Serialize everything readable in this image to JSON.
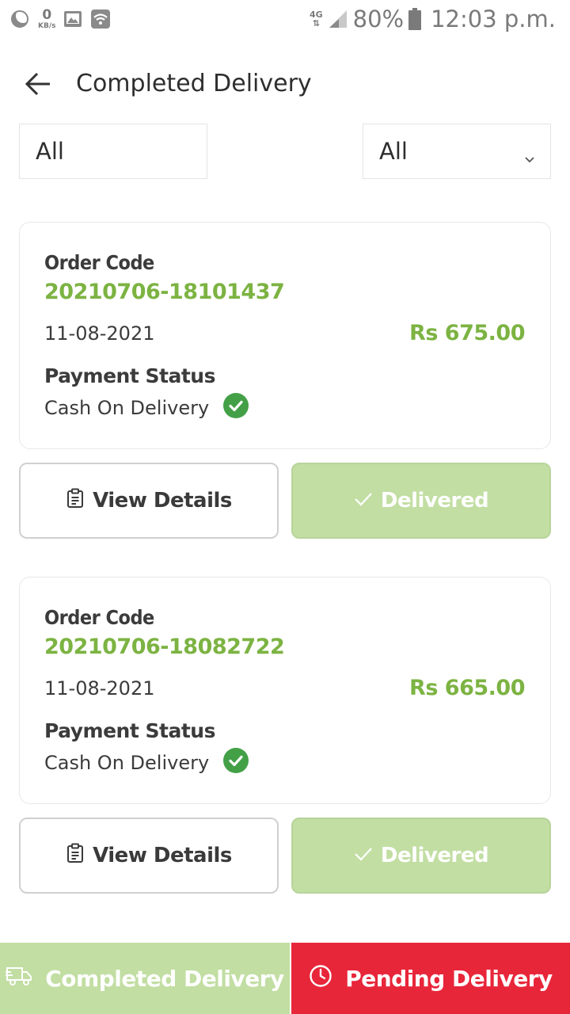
{
  "status_bar": {
    "speed_value": "0",
    "speed_unit": "KB/s",
    "network": "4G",
    "battery": "80%",
    "time": "12:03 p.m."
  },
  "header": {
    "title": "Completed Delivery"
  },
  "filters": {
    "left_value": "All",
    "right_value": "All"
  },
  "orders": [
    {
      "code_label": "Order Code",
      "code": "20210706-18101437",
      "date": "11-08-2021",
      "amount": "Rs 675.00",
      "payment_label": "Payment Status",
      "payment_method": "Cash On Delivery",
      "view_label": "View Details",
      "status_label": "Delivered"
    },
    {
      "code_label": "Order Code",
      "code": "20210706-18082722",
      "date": "11-08-2021",
      "amount": "Rs 665.00",
      "payment_label": "Payment Status",
      "payment_method": "Cash On Delivery",
      "view_label": "View Details",
      "status_label": "Delivered"
    }
  ],
  "tabs": {
    "completed_label": "Completed Delivery",
    "pending_label": "Pending Delivery"
  },
  "colors": {
    "accent_green": "#7cb342",
    "light_green": "#c2dea3",
    "pending_red": "#e8263a",
    "check_green": "#43a047"
  },
  "icons": {
    "back": "arrow-left-icon",
    "chevron": "chevron-down-icon",
    "paid": "check-circle-icon",
    "clipboard": "clipboard-icon",
    "check": "check-icon",
    "truck": "truck-icon",
    "clock": "clock-icon"
  }
}
